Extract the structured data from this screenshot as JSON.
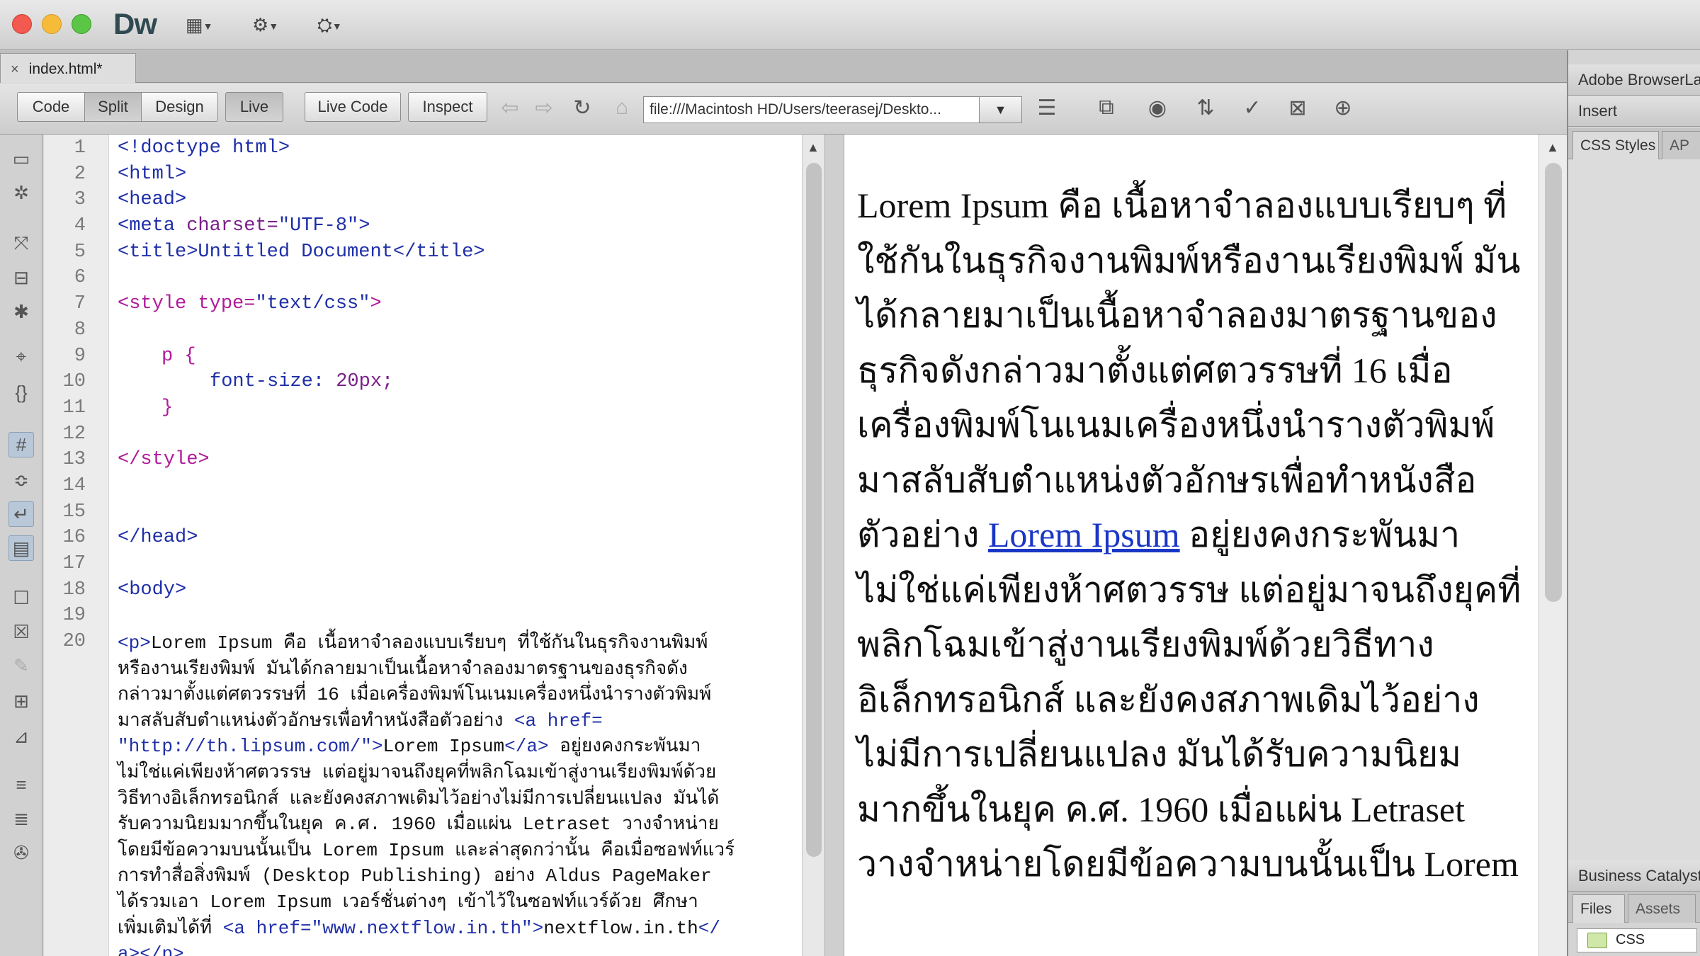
{
  "app": {
    "logo": "Dw",
    "menus": [
      {
        "icon": "layout-icon",
        "glyph": "▦"
      },
      {
        "icon": "gear-icon",
        "glyph": "⚙"
      },
      {
        "icon": "site-icon",
        "glyph": "⛭"
      }
    ]
  },
  "document_tab": {
    "close": "×",
    "name": "index.html*"
  },
  "toolbar": {
    "code": "Code",
    "split": "Split",
    "design": "Design",
    "live": "Live",
    "live_code": "Live Code",
    "inspect": "Inspect",
    "address": "file:///Macintosh HD/Users/teerasej/Deskto...",
    "address_drop": "▼"
  },
  "code": {
    "line_numbers": [
      "1",
      "2",
      "3",
      "4",
      "5",
      "6",
      "7",
      "8",
      "9",
      "10",
      "11",
      "12",
      "13",
      "14",
      "15",
      "16",
      "17",
      "18",
      "19",
      "20"
    ],
    "l1": "<!doctype html>",
    "l2": "<html>",
    "l3": "<head>",
    "l4_a": "<meta ",
    "l4_b": "charset=",
    "l4_c": "\"UTF-8\"",
    "l4_d": ">",
    "l5": "<title>Untitled Document</title>",
    "l7_a": "<style ",
    "l7_b": "type=",
    "l7_c": "\"text/css\"",
    "l7_d": ">",
    "l9": "p {",
    "l10_a": "font-size: ",
    "l10_b": "20px;",
    "l11": "}",
    "l13": "</style>",
    "l16": "</head>",
    "l18": "<body>",
    "para": {
      "p_open": "<p>",
      "t1": "Lorem Ipsum คือ เนื้อหาจำลองแบบเรียบๆ ที่ใช้กันในธุรกิจงานพิมพ์",
      "t2": "หรืองานเรียงพิมพ์ มันได้กลายมาเป็นเนื้อหาจำลองมาตรฐานของธุรกิจดัง",
      "t3": "กล่าวมาตั้งแต่ศตวรรษที่ 16 เมื่อเครื่องพิมพ์โนเนมเครื่องหนึ่งนำรางตัวพิมพ์",
      "t4": "มาสลับสับตำแหน่งตัวอักษรเพื่อทำหนังสือตัวอย่าง ",
      "a_open_1": "<a href=",
      "href_1": "\"http://th.lipsum.com/\"",
      "a_gt": ">",
      "link_text_1": "Lorem Ipsum",
      "a_close_1": "</a>",
      "t5": " อยู่ยงคงกระพันมา",
      "t6": "ไม่ใช่แค่เพียงห้าศตวรรษ แต่อยู่มาจนถึงยุคที่พลิกโฉมเข้าสู่งานเรียงพิมพ์ด้วย",
      "t7": "วิธีทางอิเล็กทรอนิกส์ และยังคงสภาพเดิมไว้อย่างไม่มีการเปลี่ยนแปลง มันได้",
      "t8": "รับความนิยมมากขึ้นในยุค ค.ศ. 1960 เมื่อแผ่น Letraset วางจำหน่าย",
      "t9": "โดยมีข้อความบนนั้นเป็น Lorem Ipsum และล่าสุดกว่านั้น คือเมื่อซอฟท์แวร์",
      "t10": "การทำสื่อสิ่งพิมพ์ (Desktop Publishing) อย่าง Aldus PageMaker",
      "t11": "ได้รวมเอา Lorem Ipsum เวอร์ชั่นต่างๆ เข้าไว้ในซอฟท์แวร์ด้วย ศึกษา",
      "t12": "เพิ่มเติมได้ที่ ",
      "a_open_2": "<a href=",
      "href_2": "\"www.nextflow.in.th\"",
      "a_gt_2": ">",
      "link_text_2": "nextflow.in.th",
      "a_close_2a": "</",
      "a_close_2b": "a>",
      "p_close": "</p>"
    }
  },
  "live": {
    "s1": "Lorem Ipsum คือ เนื้อหาจำลองแบบเรียบๆ ที่ใช้กันในธุรกิจงานพิมพ์หรืองานเรียงพิมพ์ มันได้กลายมาเป็นเนื้อหาจำลองมาตรฐานของธุรกิจดังกล่าวมาตั้งแต่ศตวรรษที่ 16 เมื่อเครื่องพิมพ์โนเนมเครื่องหนึ่งนำรางตัวพิมพ์มาสลับสับตำแหน่งตัวอักษรเพื่อทำหนังสือตัวอย่าง ",
    "link": "Lorem Ipsum",
    "s2": " อยู่ยงคงกระพันมาไม่ใช่แค่เพียงห้าศตวรรษ แต่อยู่มาจนถึงยุคที่พลิกโฉมเข้าสู่งานเรียงพิมพ์ด้วยวิธีทางอิเล็กทรอนิกส์ และยังคงสภาพเดิมไว้อย่างไม่มีการเปลี่ยนแปลง มันได้รับความนิยมมากขึ้นในยุค ค.ศ. 1960 เมื่อแผ่น Letraset วางจำหน่ายโดยมีข้อความบนนั้นเป็น Lorem"
  },
  "panels": {
    "browser_lab": "Adobe BrowserLab",
    "insert": "Insert",
    "css_styles": "CSS Styles",
    "ap": "AP",
    "business_catalyst": "Business Catalyst",
    "files": "Files",
    "assets": "Assets",
    "site": "CSS"
  }
}
